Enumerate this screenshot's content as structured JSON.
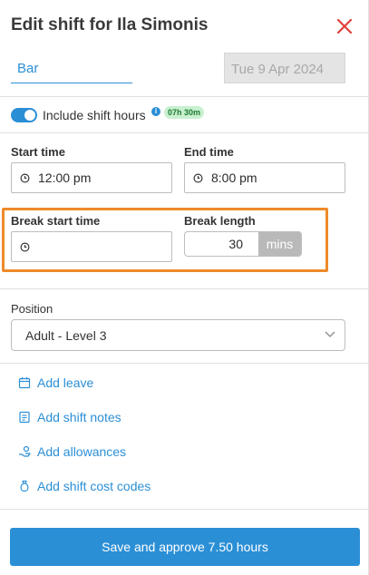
{
  "header": {
    "title": "Edit shift for Ila Simonis"
  },
  "shift": {
    "area": "Bar",
    "date": "Tue 9 Apr 2024"
  },
  "hours": {
    "toggle_label": "Include shift hours",
    "toggle_on": true,
    "badge": "07h 30m"
  },
  "times": {
    "start_label": "Start time",
    "start_value": "12:00 pm",
    "end_label": "End time",
    "end_value": "8:00 pm"
  },
  "break": {
    "start_label": "Break start time",
    "start_value": "",
    "length_label": "Break length",
    "length_value": "30",
    "length_unit": "mins"
  },
  "position": {
    "label": "Position",
    "value": "Adult - Level 3"
  },
  "actions": [
    {
      "label": "Add leave",
      "icon": "calendar-leave-icon"
    },
    {
      "label": "Add shift notes",
      "icon": "notes-icon"
    },
    {
      "label": "Add allowances",
      "icon": "allowance-hand-icon"
    },
    {
      "label": "Add shift cost codes",
      "icon": "cost-code-bag-icon"
    }
  ],
  "footer": {
    "save_label": "Save and approve 7.50 hours"
  },
  "colors": {
    "accent": "#2b8fd6",
    "highlight": "#ee8a2a",
    "close": "#e0413c",
    "badge_bg": "#c8f0cf"
  }
}
